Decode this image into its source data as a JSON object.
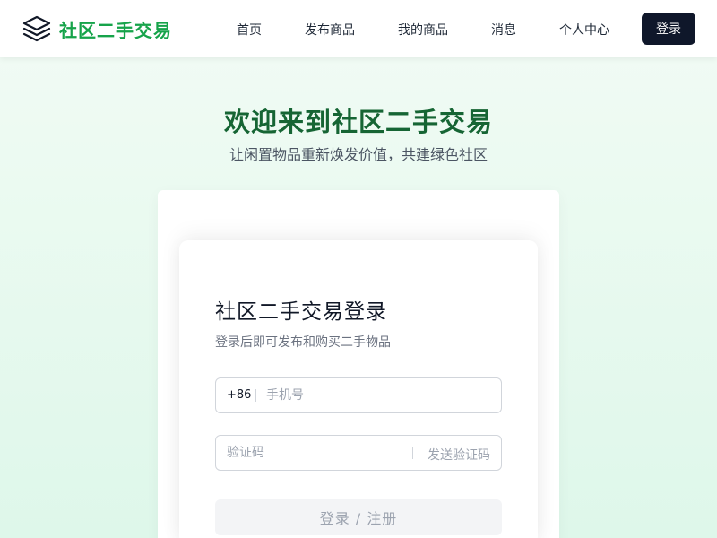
{
  "header": {
    "brand": "社区二手交易",
    "logo_icon": "layers-icon",
    "nav": [
      "首页",
      "发布商品",
      "我的商品",
      "消息",
      "个人中心"
    ],
    "login_label": "登录"
  },
  "hero": {
    "title": "欢迎来到社区二手交易",
    "subtitle": "让闲置物品重新焕发价值，共建绿色社区"
  },
  "form": {
    "title": "社区二手交易登录",
    "subtitle": "登录后即可发布和购买二手物品",
    "phone_prefix": "+86",
    "phone_placeholder": "手机号",
    "code_placeholder": "验证码",
    "send_code_label": "发送验证码",
    "submit_label": "登录 / 注册"
  },
  "colors": {
    "brand": "#16a34a",
    "hero_title": "#166534",
    "login_button": "#0f172a"
  }
}
